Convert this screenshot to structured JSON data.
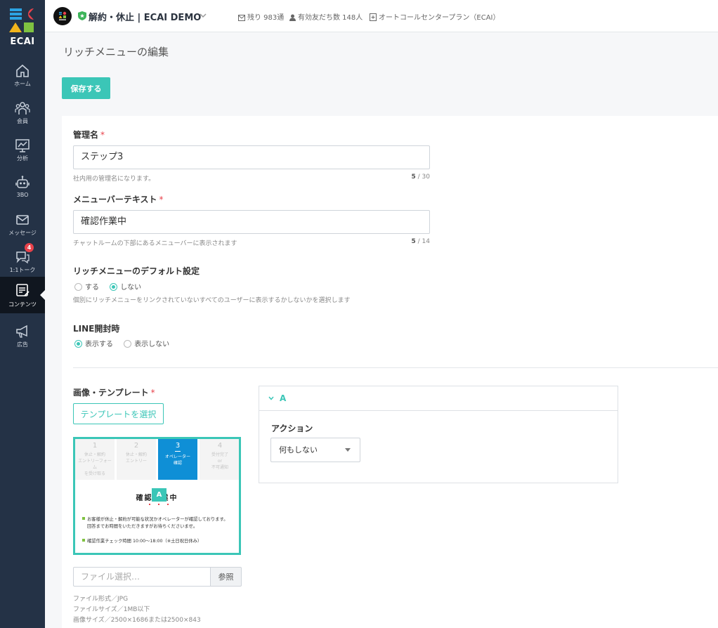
{
  "app": {
    "logo_text": "ECAI",
    "account_name": "解約・休止 | ECAI DEMO",
    "stats": [
      {
        "icon": "mail-icon",
        "text": "残り 983通"
      },
      {
        "icon": "user-icon",
        "text": "有効友だち数 148人"
      },
      {
        "icon": "plan-icon",
        "text": "オートコールセンタープラン（ECAI）"
      }
    ]
  },
  "sidebar": {
    "items": [
      {
        "label": "ホーム",
        "icon": "home-icon"
      },
      {
        "label": "会員",
        "icon": "members-icon"
      },
      {
        "label": "分析",
        "icon": "analytics-icon"
      },
      {
        "label": "3BO",
        "icon": "robot-icon"
      },
      {
        "label": "メッセージ",
        "icon": "message-icon"
      },
      {
        "label": "1:1トーク",
        "icon": "chat-icon",
        "badge": "4"
      },
      {
        "label": "コンテンツ",
        "icon": "content-icon",
        "active": true
      },
      {
        "label": "広告",
        "icon": "megaphone-icon"
      }
    ]
  },
  "page": {
    "title": "リッチメニューの編集",
    "save_label": "保存する"
  },
  "form": {
    "name": {
      "label": "管理名",
      "required": "*",
      "value": "ステップ3",
      "help": "社内用の管理名になります。",
      "count": "5",
      "max": "/ 30"
    },
    "bar_text": {
      "label": "メニューバーテキスト",
      "required": "*",
      "value": "確認作業中",
      "help": "チャットルームの下部にあるメニューバーに表示されます",
      "count": "5",
      "max": "/ 14"
    },
    "default": {
      "label": "リッチメニューのデフォルト設定",
      "options": [
        "する",
        "しない"
      ],
      "selected": "しない",
      "help": "個別にリッチメニューをリンクされていないすべてのユーザーに表示するかしないかを選択します"
    },
    "line_open": {
      "label": "LINE開封時",
      "options": [
        "表示する",
        "表示しない"
      ],
      "selected": "表示する"
    },
    "image": {
      "label": "画像・テンプレート",
      "required": "*",
      "template_button": "テンプレートを選択",
      "file_placeholder": "ファイル選択…",
      "browse_label": "参照",
      "notes": [
        "ファイル形式／JPG",
        "ファイルサイズ／1MB以下",
        "画像サイズ／2500×1686または2500×843"
      ]
    }
  },
  "preview": {
    "steps": [
      {
        "num": "1",
        "text": "休止・解約\nエントリーフォーム\nを受け取る"
      },
      {
        "num": "2",
        "text": "休止・解約\nエントリー"
      },
      {
        "num": "3",
        "text": "オペレーター\n確認",
        "active": true
      },
      {
        "num": "4",
        "text": "受付完了\nor\n不可通知"
      }
    ],
    "heading": "確認作業中",
    "marker": "A",
    "lines": [
      "お客様が休止・解約が可能な状況かオペレーターが確認しております。",
      "回答までお時間をいただきますがお待ちくださいませ。",
      "確認作業チェック時間 10:00〜18:00（※土日祝日休み）"
    ]
  },
  "action_panel": {
    "area": "A",
    "action_label": "アクション",
    "action_value": "何もしない"
  },
  "colors": {
    "accent": "#3bc6b7",
    "sidebar": "#243246",
    "step_active": "#0f8fd6",
    "badge": "#e8424b"
  }
}
